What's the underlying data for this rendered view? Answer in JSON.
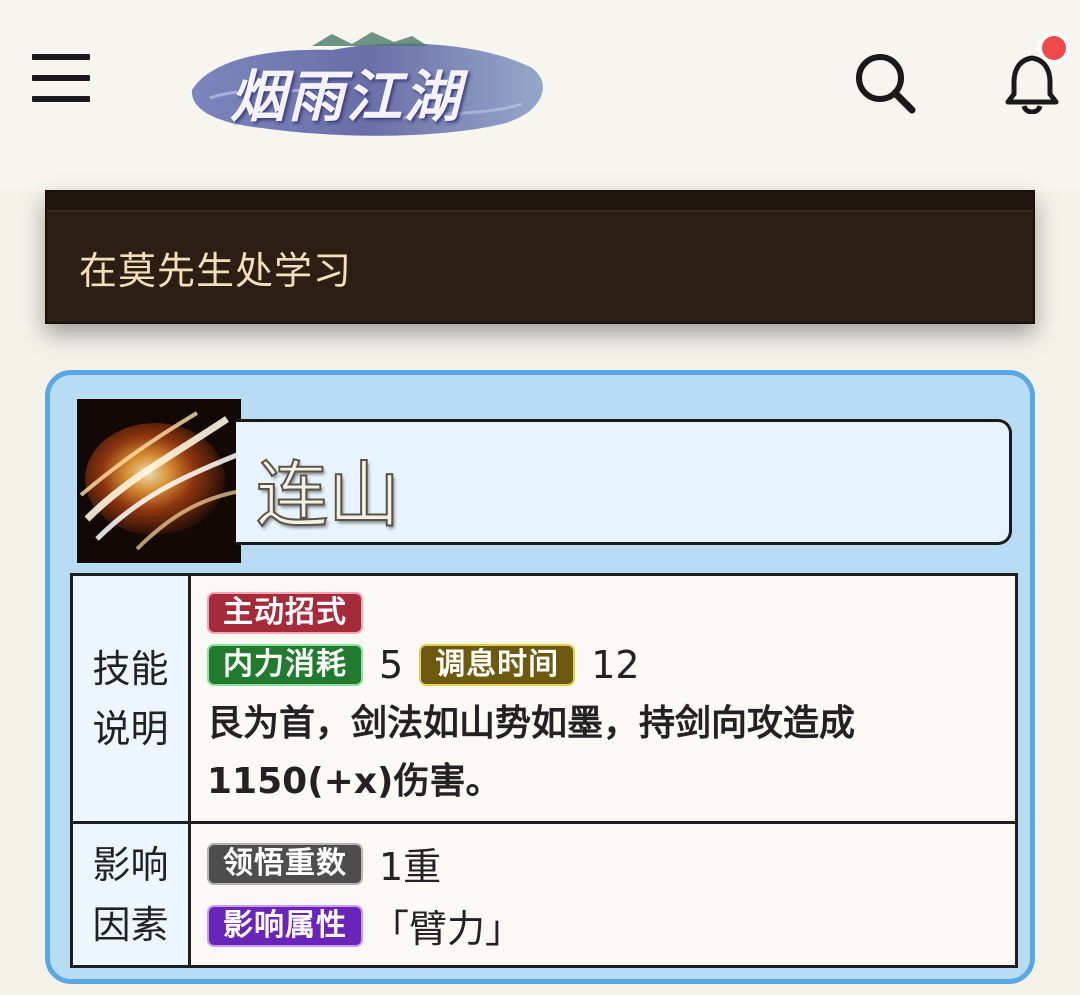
{
  "header": {
    "logo_text": "烟雨江湖"
  },
  "banner": {
    "text": "在莫先生处学习"
  },
  "skill": {
    "name": "连山",
    "rows": [
      {
        "label_line1": "技能",
        "label_line2": "说明",
        "tag_type": "主动招式",
        "tag_neili": "内力消耗",
        "neili_value": "5",
        "tag_tiaoxi": "调息时间",
        "tiaoxi_value": "12",
        "description": "艮为首，剑法如山势如墨，持剑向攻造成1150(+x)伤害。"
      },
      {
        "label_line1": "影响",
        "label_line2": "因素",
        "tag_lingwu": "领悟重数",
        "lingwu_value": "1重",
        "tag_attr": "影响属性",
        "attr_value": "「臂力」"
      }
    ]
  },
  "colors": {
    "card_bg": "#b9dcf5",
    "card_border": "#5aa7e6",
    "banner_bg": "#2d1e14",
    "notification_dot": "#ee4a4a"
  }
}
